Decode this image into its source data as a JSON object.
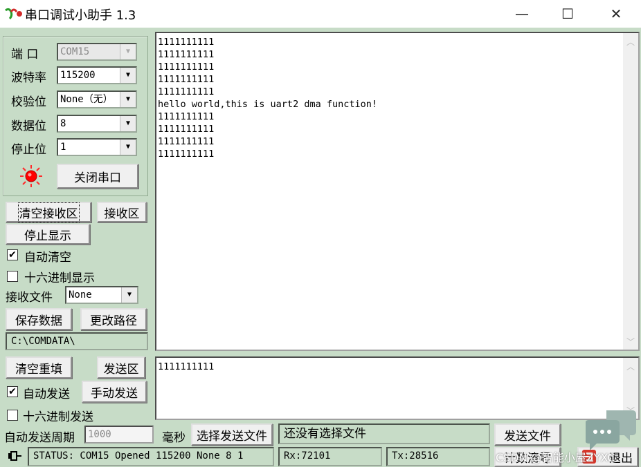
{
  "window": {
    "title": "串口调试小助手 1.3",
    "controls": {
      "minimize": "—",
      "maximize": "☐",
      "close": "✕"
    }
  },
  "port_settings": {
    "port_label": "端  口",
    "port_value": "COM15",
    "baud_label": "波特率",
    "baud_value": "115200",
    "parity_label": "校验位",
    "parity_value": "None（无）",
    "databits_label": "数据位",
    "databits_value": "8",
    "stopbits_label": "停止位",
    "stopbits_value": "1",
    "close_port_label": "关闭串口",
    "indicator_color": "#ff0000"
  },
  "receive": {
    "clear_label": "清空接收区",
    "area_label": "接收区",
    "stop_display_label": "停止显示",
    "auto_clear_label": "自动清空",
    "hex_display_label": "十六进制显示",
    "file_label": "接收文件",
    "file_value": "None",
    "save_label": "保存数据",
    "change_path_label": "更改路径",
    "path": "C:\\COMDATA\\",
    "lines": [
      "1111111111",
      "1111111111",
      "1111111111",
      "1111111111",
      "1111111111",
      "hello world,this is uart2 dma function!",
      "1111111111",
      "1111111111",
      "1111111111",
      "1111111111"
    ]
  },
  "send": {
    "clear_label": "清空重填",
    "area_label": "发送区",
    "auto_send_label": "自动发送",
    "manual_send_label": "手动发送",
    "hex_send_label": "十六进制发送",
    "period_label": "自动发送周期",
    "period_value": "1000",
    "ms_label": "毫秒",
    "choose_file_label": "选择发送文件",
    "file_status": "还没有选择文件",
    "send_file_label": "发送文件",
    "text": "1111111111"
  },
  "status": {
    "text": "STATUS: COM15 Opened 115200 None  8 1",
    "rx": "Rx:72101",
    "tx": "Tx:28516",
    "count_clear_label": "计数清零",
    "exit_label": "退出"
  },
  "watermark": "CSDN @智能小屋ZYXC"
}
